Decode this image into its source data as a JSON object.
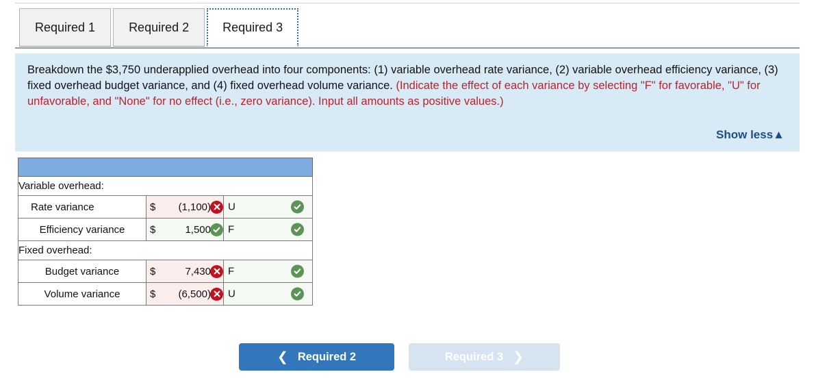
{
  "tabs": [
    {
      "label": "Required 1",
      "active": false
    },
    {
      "label": "Required 2",
      "active": false
    },
    {
      "label": "Required 3",
      "active": true
    }
  ],
  "instructions": {
    "black_part_1": "Breakdown the $3,750 underapplied overhead into four components: (1) variable overhead rate variance, (2) variable overhead efficiency variance, (3) fixed overhead budget variance, and (4) fixed overhead volume variance. ",
    "red_part": "(Indicate the effect of each variance by selecting \"F\" for favorable, \"U\" for unfavorable, and \"None\" for no effect (i.e., zero variance). Input all amounts as positive values.)",
    "show_less_label": "Show less",
    "show_less_icon": "triangle-up-icon"
  },
  "table": {
    "header_label": "",
    "rows": [
      {
        "type": "section",
        "label": "Variable overhead:"
      },
      {
        "type": "entry",
        "label": "Rate variance",
        "multiline": false,
        "currency": "$",
        "amount": "(1,100)",
        "amount_status": "incorrect",
        "effect": "U",
        "effect_status": "correct"
      },
      {
        "type": "entry",
        "label": "Efficiency variance",
        "multiline": true,
        "currency": "$",
        "amount": "1,500",
        "amount_status": "correct",
        "effect": "F",
        "effect_status": "correct"
      },
      {
        "type": "section",
        "label": "Fixed overhead:"
      },
      {
        "type": "entry",
        "label": "Budget variance",
        "multiline": true,
        "currency": "$",
        "amount": "7,430",
        "amount_status": "incorrect",
        "effect": "F",
        "effect_status": "correct"
      },
      {
        "type": "entry",
        "label": "Volume variance",
        "multiline": true,
        "currency": "$",
        "amount": "(6,500)",
        "amount_status": "incorrect",
        "effect": "U",
        "effect_status": "correct"
      }
    ]
  },
  "nav": {
    "prev_label": "Required 2",
    "prev_icon": "chevron-left-icon",
    "next_label": "Required 3",
    "next_icon": "chevron-right-icon"
  },
  "colors": {
    "tab_active_outline": "#2f6fb0",
    "instruction_panel_bg": "#d9eaf7",
    "instruction_red": "#c0202a",
    "show_less": "#1b4f8a",
    "table_header_bg": "#7cacdf",
    "incorrect_badge": "#c2101f",
    "correct_badge": "#5c9356",
    "incorrect_cell_bg": "#fdeeee",
    "correct_cell_bg": "#f4faf3",
    "nav_prev_bg": "#3276bc",
    "nav_next_bg": "#d6e4f2"
  }
}
